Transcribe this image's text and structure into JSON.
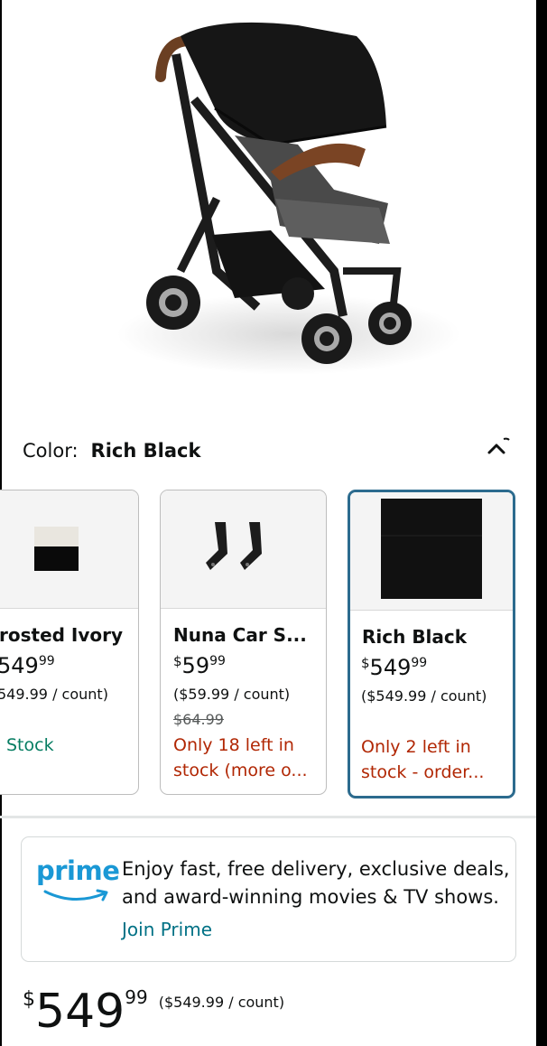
{
  "color": {
    "label": "Color:",
    "value": "Rich Black"
  },
  "variants": [
    {
      "name": "rosted Ivory",
      "price_whole": "549",
      "price_cents": "99",
      "unit_price": "549.99 / count)",
      "list_price": "",
      "stock": "Stock",
      "stock_color": "#067d62"
    },
    {
      "name": "Nuna Car S...",
      "price_symbol": "$",
      "price_whole": "59",
      "price_cents": "99",
      "unit_price": "($59.99 / count)",
      "list_price": "$64.99",
      "stock_line1": "Only 18 left in",
      "stock_line2": "stock (more o...",
      "stock_color": "#b12704"
    },
    {
      "name": "Rich Black",
      "price_symbol": "$",
      "price_whole": "549",
      "price_cents": "99",
      "unit_price": "($549.99 / count)",
      "list_price": "",
      "stock_line1": "Only 2 left in",
      "stock_line2": "stock - order...",
      "stock_color": "#b12704",
      "selected": true
    }
  ],
  "prime": {
    "logo": "prime",
    "message": "Enjoy fast, free delivery, exclusive deals, and award-winning movies & TV shows.",
    "cta": "Join Prime"
  },
  "price": {
    "symbol": "$",
    "whole": "549",
    "cents": "99",
    "unit": "($549.99 / count)"
  },
  "colors": {
    "accent": "#2c6b8e",
    "link": "#007185",
    "in_stock": "#067d62",
    "low_stock": "#b12704",
    "prime_blue": "#1a98d5"
  }
}
